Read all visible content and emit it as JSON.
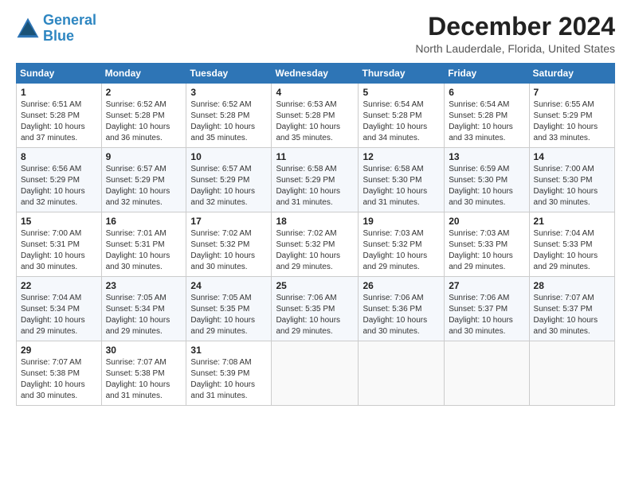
{
  "logo": {
    "line1": "General",
    "line2": "Blue"
  },
  "title": "December 2024",
  "location": "North Lauderdale, Florida, United States",
  "days_of_week": [
    "Sunday",
    "Monday",
    "Tuesday",
    "Wednesday",
    "Thursday",
    "Friday",
    "Saturday"
  ],
  "weeks": [
    [
      {
        "day": 1,
        "sunrise": "6:51 AM",
        "sunset": "5:28 PM",
        "daylight": "10 hours and 37 minutes."
      },
      {
        "day": 2,
        "sunrise": "6:52 AM",
        "sunset": "5:28 PM",
        "daylight": "10 hours and 36 minutes."
      },
      {
        "day": 3,
        "sunrise": "6:52 AM",
        "sunset": "5:28 PM",
        "daylight": "10 hours and 35 minutes."
      },
      {
        "day": 4,
        "sunrise": "6:53 AM",
        "sunset": "5:28 PM",
        "daylight": "10 hours and 35 minutes."
      },
      {
        "day": 5,
        "sunrise": "6:54 AM",
        "sunset": "5:28 PM",
        "daylight": "10 hours and 34 minutes."
      },
      {
        "day": 6,
        "sunrise": "6:54 AM",
        "sunset": "5:28 PM",
        "daylight": "10 hours and 33 minutes."
      },
      {
        "day": 7,
        "sunrise": "6:55 AM",
        "sunset": "5:29 PM",
        "daylight": "10 hours and 33 minutes."
      }
    ],
    [
      {
        "day": 8,
        "sunrise": "6:56 AM",
        "sunset": "5:29 PM",
        "daylight": "10 hours and 32 minutes."
      },
      {
        "day": 9,
        "sunrise": "6:57 AM",
        "sunset": "5:29 PM",
        "daylight": "10 hours and 32 minutes."
      },
      {
        "day": 10,
        "sunrise": "6:57 AM",
        "sunset": "5:29 PM",
        "daylight": "10 hours and 32 minutes."
      },
      {
        "day": 11,
        "sunrise": "6:58 AM",
        "sunset": "5:29 PM",
        "daylight": "10 hours and 31 minutes."
      },
      {
        "day": 12,
        "sunrise": "6:58 AM",
        "sunset": "5:30 PM",
        "daylight": "10 hours and 31 minutes."
      },
      {
        "day": 13,
        "sunrise": "6:59 AM",
        "sunset": "5:30 PM",
        "daylight": "10 hours and 30 minutes."
      },
      {
        "day": 14,
        "sunrise": "7:00 AM",
        "sunset": "5:30 PM",
        "daylight": "10 hours and 30 minutes."
      }
    ],
    [
      {
        "day": 15,
        "sunrise": "7:00 AM",
        "sunset": "5:31 PM",
        "daylight": "10 hours and 30 minutes."
      },
      {
        "day": 16,
        "sunrise": "7:01 AM",
        "sunset": "5:31 PM",
        "daylight": "10 hours and 30 minutes."
      },
      {
        "day": 17,
        "sunrise": "7:02 AM",
        "sunset": "5:32 PM",
        "daylight": "10 hours and 30 minutes."
      },
      {
        "day": 18,
        "sunrise": "7:02 AM",
        "sunset": "5:32 PM",
        "daylight": "10 hours and 29 minutes."
      },
      {
        "day": 19,
        "sunrise": "7:03 AM",
        "sunset": "5:32 PM",
        "daylight": "10 hours and 29 minutes."
      },
      {
        "day": 20,
        "sunrise": "7:03 AM",
        "sunset": "5:33 PM",
        "daylight": "10 hours and 29 minutes."
      },
      {
        "day": 21,
        "sunrise": "7:04 AM",
        "sunset": "5:33 PM",
        "daylight": "10 hours and 29 minutes."
      }
    ],
    [
      {
        "day": 22,
        "sunrise": "7:04 AM",
        "sunset": "5:34 PM",
        "daylight": "10 hours and 29 minutes."
      },
      {
        "day": 23,
        "sunrise": "7:05 AM",
        "sunset": "5:34 PM",
        "daylight": "10 hours and 29 minutes."
      },
      {
        "day": 24,
        "sunrise": "7:05 AM",
        "sunset": "5:35 PM",
        "daylight": "10 hours and 29 minutes."
      },
      {
        "day": 25,
        "sunrise": "7:06 AM",
        "sunset": "5:35 PM",
        "daylight": "10 hours and 29 minutes."
      },
      {
        "day": 26,
        "sunrise": "7:06 AM",
        "sunset": "5:36 PM",
        "daylight": "10 hours and 30 minutes."
      },
      {
        "day": 27,
        "sunrise": "7:06 AM",
        "sunset": "5:37 PM",
        "daylight": "10 hours and 30 minutes."
      },
      {
        "day": 28,
        "sunrise": "7:07 AM",
        "sunset": "5:37 PM",
        "daylight": "10 hours and 30 minutes."
      }
    ],
    [
      {
        "day": 29,
        "sunrise": "7:07 AM",
        "sunset": "5:38 PM",
        "daylight": "10 hours and 30 minutes."
      },
      {
        "day": 30,
        "sunrise": "7:07 AM",
        "sunset": "5:38 PM",
        "daylight": "10 hours and 31 minutes."
      },
      {
        "day": 31,
        "sunrise": "7:08 AM",
        "sunset": "5:39 PM",
        "daylight": "10 hours and 31 minutes."
      },
      null,
      null,
      null,
      null
    ]
  ]
}
